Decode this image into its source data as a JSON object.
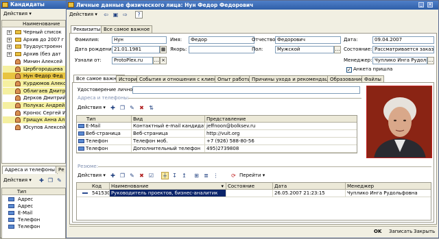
{
  "left_window": {
    "title": "Кандидаты",
    "actions_label": "Действия",
    "column_header": "Наименование",
    "rows": [
      {
        "label": "Черный список",
        "kind": "folder",
        "bg": "#ffffff"
      },
      {
        "label": "Архив до 2007 г",
        "kind": "folder",
        "bg": "#ffffff"
      },
      {
        "label": "Трудоустроенн",
        "kind": "folder",
        "bg": "#ffffff"
      },
      {
        "label": "Архив (без дат",
        "kind": "folder",
        "bg": "#ffffff"
      },
      {
        "label": "Минин Алексей",
        "kind": "person",
        "bg": "#ffffff"
      },
      {
        "label": "Цербгородцева",
        "kind": "person",
        "bg": "#f5f0a0"
      },
      {
        "label": "Нун Федор Фед",
        "kind": "person",
        "bg": "#e8c440"
      },
      {
        "label": "Курдюмов Алекс",
        "kind": "person",
        "bg": "#f5f0a0"
      },
      {
        "label": "Облигаев Дмитр",
        "kind": "person",
        "bg": "#f5f0a0"
      },
      {
        "label": "Дерков Дмитрий",
        "kind": "person",
        "bg": "#ffffff"
      },
      {
        "label": "Полукас Андрей",
        "kind": "person",
        "bg": "#f5f0a0"
      },
      {
        "label": "Кронос Сергей И",
        "kind": "person",
        "bg": "#ffffff"
      },
      {
        "label": "Грищук Анна Ал",
        "kind": "person",
        "bg": "#f5f0a0"
      },
      {
        "label": "Юсупов Алексей",
        "kind": "person",
        "bg": "#ffffff"
      }
    ],
    "bottom_tabs": [
      "Адреса и телефоны",
      "Ре"
    ],
    "bottom_actions_label": "Действия",
    "bottom_column_header": "Тип",
    "bottom_rows": [
      "Адрес",
      "Адрес",
      "E-Mail",
      "Телефон",
      "Телефон"
    ]
  },
  "main_window": {
    "title": "Личные данные физического лица: Нун Федор Федорович",
    "actions_label": "Действия",
    "top_tabs": [
      "Реквизиты",
      "Все самое важное"
    ],
    "fields": {
      "surname_label": "Фамилия:",
      "surname_value": "Нун",
      "name_label": "Имя:",
      "name_value": "Федор",
      "patronymic_label": "Отчество:",
      "patronymic_value": "Федорович",
      "date_label": "Дата:",
      "date_value": "09.04.2007",
      "birth_label": "Дата рождения:",
      "birth_value": "21.01.1981",
      "anchor_label": "Якорь:",
      "anchor_value": "",
      "sex_label": "Пол:",
      "sex_value": "Мужской",
      "state_label": "Состояние:",
      "state_value": "Рассматривается заказч",
      "source_label": "Узнали от:",
      "source_value": "ProtoPlex.ru",
      "manager_label": "Менеджер:",
      "manager_value": "Чуплико Инга Рудольфо",
      "form_received_label": "Анкета пришла"
    },
    "sub_tabs": [
      "Все самое важное",
      "История",
      "События и отношения с клиентами",
      "Опыт работы",
      "Причины ухода и рекомендации",
      "Образование",
      "Файлы"
    ],
    "id_label": "Удостоверение личности:",
    "addresses_group_title": "Адреса и телефоны:",
    "addr_actions_label": "Действия",
    "addr_headers": [
      "Тип",
      "Вид",
      "Представление"
    ],
    "addr_rows": [
      {
        "type": "E-Mail",
        "kind": "Контактный e-mail кандидата",
        "value": "jeffnoon@bolksev.ru"
      },
      {
        "type": "Веб-страница",
        "kind": "Веб-страница",
        "value": "http://vuit.org"
      },
      {
        "type": "Телефон",
        "kind": "Телефон моб.",
        "value": "+7 (926) 588-80-56"
      },
      {
        "type": "Телефон",
        "kind": "Дополнительный телефон",
        "value": "495)2739808"
      }
    ],
    "resume_group_title": "Резюме:",
    "resume_actions_label": "Действия",
    "resume_goto_label": "Перейти",
    "resume_headers": [
      "Код",
      "Наименование",
      "Состояние",
      "Дата",
      "Менеджер"
    ],
    "resume_rows": [
      {
        "code": "541530",
        "name": "Руководитель проектов, бизнес-аналитик",
        "state": "",
        "date": "26.05.2007 21:23:15",
        "manager": "Чуплико Инга Рудольфовна"
      }
    ],
    "footer": {
      "ok": "OK",
      "save": "Записать",
      "close": "Закрыть"
    }
  },
  "colors": {
    "title_bar": "#2f5fa8",
    "selected_row": "#0a246a",
    "yellow_row": "#f5f0a0",
    "highlight_row": "#e8c440"
  }
}
